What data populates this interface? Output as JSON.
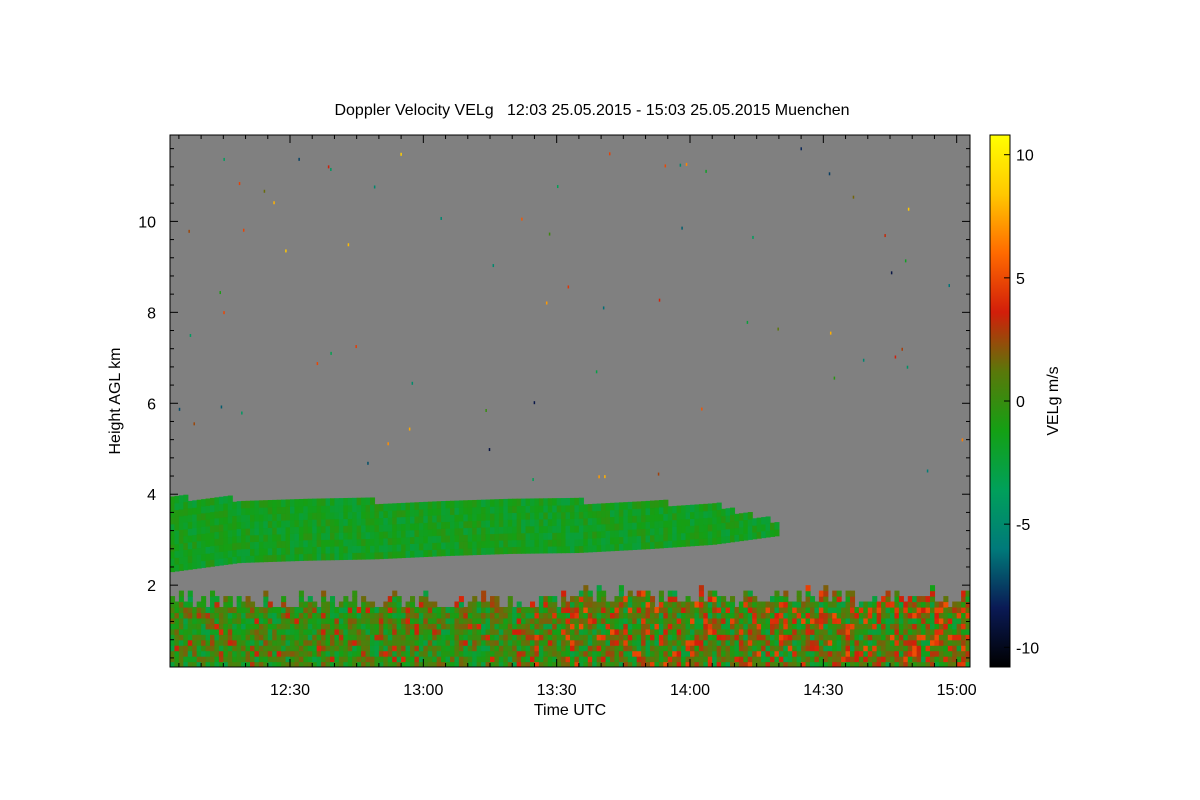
{
  "chart_data": {
    "type": "heatmap",
    "title": "Doppler Velocity VELg   12:03 25.05.2015 - 15:03 25.05.2015 Muenchen",
    "xlabel": "Time UTC",
    "ylabel": "Height AGL km",
    "colorbar_label": "VELg m/s",
    "xlim": [
      "12:03",
      "15:03"
    ],
    "ylim": [
      0.2,
      11.9
    ],
    "x_ticks": [
      "12:30",
      "13:00",
      "13:30",
      "14:00",
      "14:30",
      "15:00"
    ],
    "y_ticks": [
      2,
      4,
      6,
      8,
      10
    ],
    "colorbar_range": [
      -10.8,
      10.8
    ],
    "colorbar_ticks": [
      10,
      5,
      0,
      -5,
      -10
    ],
    "colormap": [
      "#000000",
      "#0a1a55",
      "#007a7a",
      "#00a05a",
      "#14a014",
      "#5a780a",
      "#d21e0a",
      "#ff6a00",
      "#ffc800",
      "#ffff00"
    ],
    "background_color": "#808080",
    "layers": [
      {
        "name": "cloud layer",
        "time_start": "12:03",
        "time_end": "14:20",
        "top_km": [
          3.85,
          3.82,
          3.78,
          3.78,
          3.8,
          3.79,
          3.78,
          3.75,
          3.7,
          3.3
        ],
        "base_km": [
          2.3,
          2.5,
          2.55,
          2.58,
          2.65,
          2.7,
          2.72,
          2.8,
          2.9,
          3.1
        ],
        "velocity_ms": -1.5
      },
      {
        "name": "boundary layer",
        "time_start": "12:03",
        "time_end": "15:03",
        "top_km": 1.6,
        "base_km": 0.2,
        "velocity_range_ms": [
          -2.5,
          2.5
        ]
      }
    ]
  }
}
